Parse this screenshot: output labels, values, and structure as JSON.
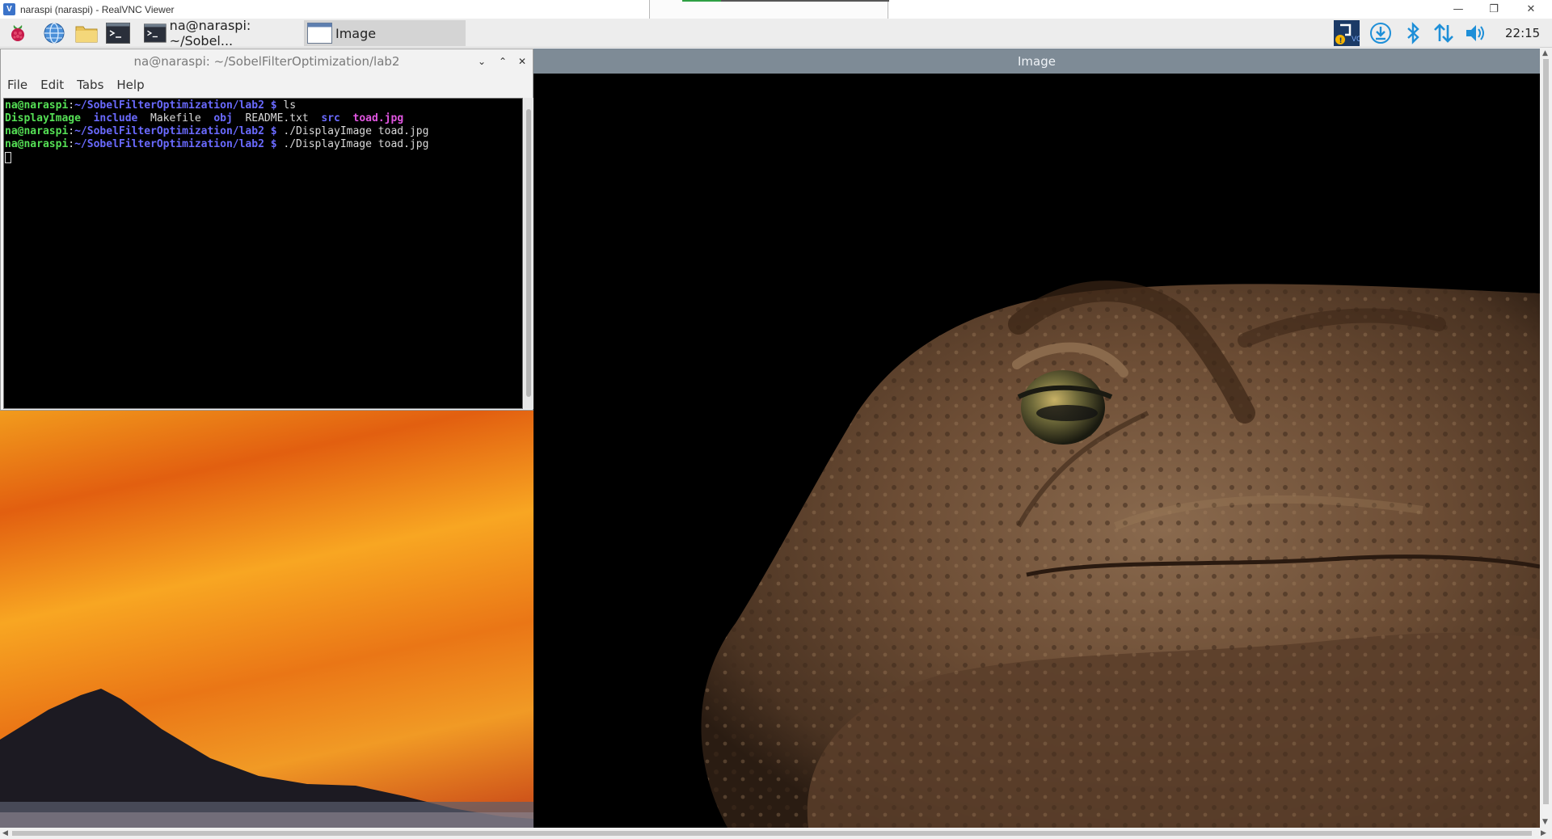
{
  "vnc": {
    "title": "naraspi (naraspi) - RealVNC Viewer",
    "logo_glyph": "V",
    "minimize": "—",
    "restore": "❐",
    "close": "✕"
  },
  "taskbar": {
    "tasks": [
      {
        "label": "na@naraspi: ~/Sobel...",
        "icon": "terminal-icon"
      },
      {
        "label": "Image",
        "icon": "window-icon"
      }
    ],
    "tray_icons": [
      "vnc-server-icon",
      "download-icon",
      "bluetooth-icon",
      "network-icon",
      "volume-icon"
    ],
    "clock": "22:15"
  },
  "terminal": {
    "title": "na@naraspi: ~/SobelFilterOptimization/lab2",
    "menu": [
      "File",
      "Edit",
      "Tabs",
      "Help"
    ],
    "prompt_user": "na@naraspi",
    "prompt_sep": ":",
    "prompt_path": "~/SobelFilterOptimization/lab2 $",
    "commands": {
      "cmd1": " ls",
      "cmd2": " ./DisplayImage toad.jpg",
      "cmd3": " ./DisplayImage toad.jpg"
    },
    "ls_output": {
      "f1": "DisplayImage",
      "f2": "include",
      "f3": "Makefile",
      "f4": "obj",
      "f5": "README.txt",
      "f6": "src",
      "f7": "toad.jpg"
    }
  },
  "image_window": {
    "title": "Image",
    "content": "toad-photo"
  },
  "colors": {
    "terminal_bg": "#000000",
    "prompt_green": "#55e055",
    "prompt_blue": "#6a6aff",
    "image_titlebar": "#7e8b96"
  }
}
